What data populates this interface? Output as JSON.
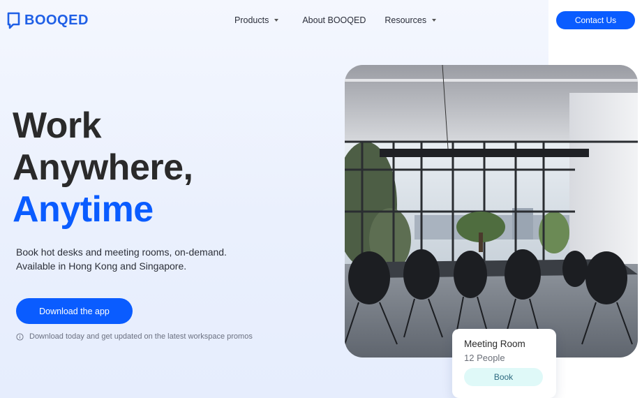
{
  "brand": {
    "name": "BOOQED",
    "logo_icon": "booqed-logo-icon",
    "color": "#1f5fe6"
  },
  "nav": {
    "items": [
      {
        "label": "Products",
        "has_dropdown": true
      },
      {
        "label": "About BOOQED",
        "has_dropdown": false
      },
      {
        "label": "Resources",
        "has_dropdown": true
      }
    ],
    "contact_label": "Contact Us"
  },
  "hero": {
    "line1": "Work",
    "line2": "Anywhere,",
    "line3": "Anytime",
    "subtitle": "Book hot desks and meeting rooms, on-demand. Available in Hong Kong and Singapore.",
    "cta_label": "Download the app",
    "note": "Download today and get updated on the latest workspace promos",
    "note_icon": "info-icon"
  },
  "room_card": {
    "title": "Meeting Room",
    "capacity": "12 People",
    "book_label": "Book"
  },
  "colors": {
    "accent": "#0a5cff",
    "book_bg": "#dff9f8"
  }
}
